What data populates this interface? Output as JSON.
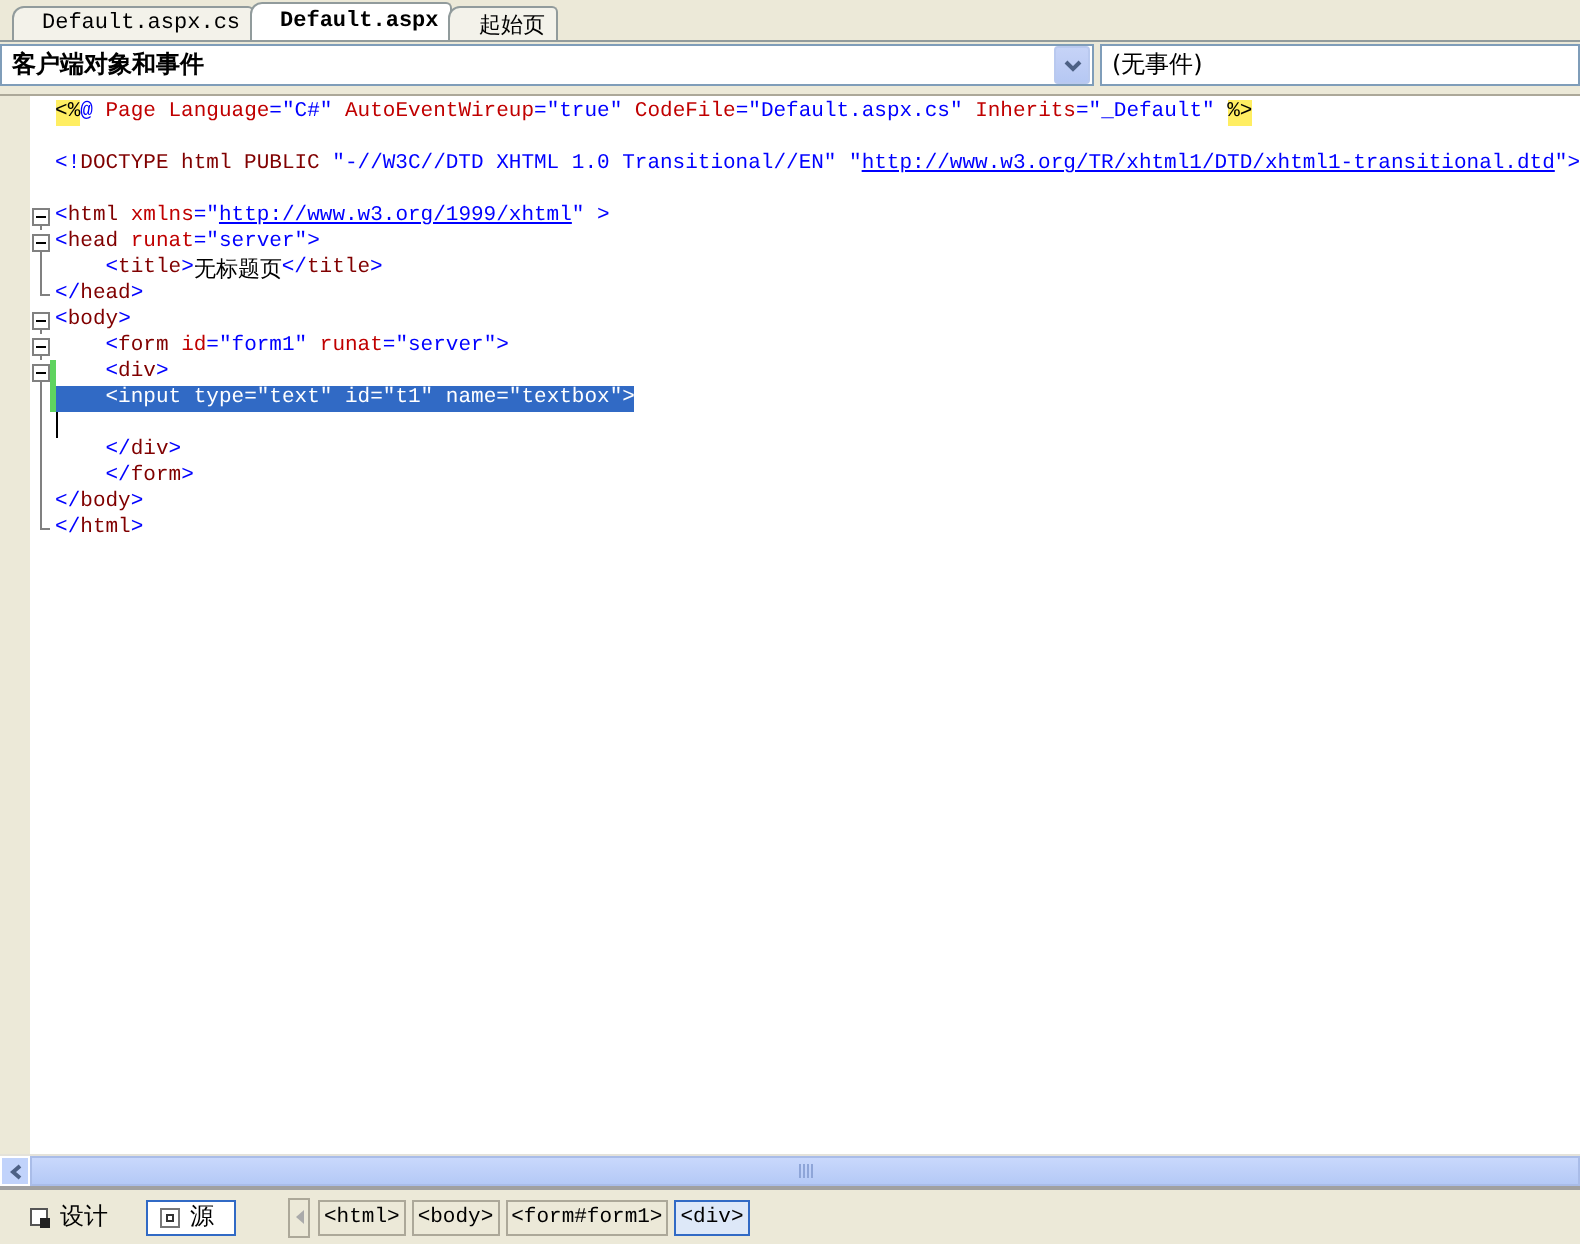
{
  "tabs": [
    {
      "label": "Default.aspx.cs",
      "selected": false
    },
    {
      "label": "Default.aspx",
      "selected": true
    },
    {
      "label": "起始页",
      "selected": false
    }
  ],
  "object_dropdown": {
    "value": "客户端对象和事件"
  },
  "event_dropdown": {
    "value": "(无事件)"
  },
  "code_lines": [
    {
      "kind": "plain",
      "changed": false,
      "selected": false,
      "cursor": false,
      "tokens": [
        {
          "kind": "directive",
          "text": "<%"
        },
        {
          "kind": "value",
          "text": "@"
        },
        {
          "kind": "attr",
          "text": " Page Language"
        },
        {
          "kind": "value",
          "text": "=\"C#\""
        },
        {
          "kind": "attr",
          "text": " AutoEventWireup"
        },
        {
          "kind": "value",
          "text": "=\"true\""
        },
        {
          "kind": "attr",
          "text": " CodeFile"
        },
        {
          "kind": "value",
          "text": "=\"Default.aspx.cs\""
        },
        {
          "kind": "attr",
          "text": " Inherits"
        },
        {
          "kind": "value",
          "text": "=\"_Default\" "
        },
        {
          "kind": "directive",
          "text": "%>"
        }
      ]
    },
    {
      "kind": "plain",
      "changed": false,
      "selected": false,
      "cursor": false
    },
    {
      "kind": "plain",
      "changed": false,
      "selected": false,
      "cursor": false,
      "tokens": [
        {
          "kind": "value",
          "text": "<!"
        },
        {
          "kind": "tag",
          "text": "DOCTYPE html PUBLIC"
        },
        {
          "kind": "value",
          "text": " \"-//W3C//DTD XHTML 1.0 Transitional//EN\" \""
        },
        {
          "kind": "link",
          "text": "http://www.w3.org/TR/xhtml1/DTD/xhtml1-transitional.dtd"
        },
        {
          "kind": "value",
          "text": "\">"
        }
      ]
    },
    {
      "kind": "plain",
      "changed": false,
      "selected": false,
      "cursor": false
    },
    {
      "kind": "open",
      "changed": false,
      "selected": false,
      "cursor": false,
      "tokens": [
        {
          "kind": "value",
          "text": "<"
        },
        {
          "kind": "tag",
          "text": "html"
        },
        {
          "kind": "attr",
          "text": " xmlns"
        },
        {
          "kind": "value",
          "text": "=\""
        },
        {
          "kind": "link",
          "text": "http://www.w3.org/1999/xhtml"
        },
        {
          "kind": "value",
          "text": "\" >"
        }
      ]
    },
    {
      "kind": "open",
      "changed": false,
      "selected": false,
      "cursor": false,
      "tokens": [
        {
          "kind": "value",
          "text": "<"
        },
        {
          "kind": "tag",
          "text": "head"
        },
        {
          "kind": "attr",
          "text": " runat"
        },
        {
          "kind": "value",
          "text": "=\"server\">"
        }
      ]
    },
    {
      "kind": "line",
      "changed": false,
      "selected": false,
      "cursor": false,
      "tokens": [
        {
          "kind": "value",
          "text": "    <"
        },
        {
          "kind": "tag",
          "text": "title"
        },
        {
          "kind": "value",
          "text": ">"
        },
        {
          "kind": "plain",
          "text": "无标题页"
        },
        {
          "kind": "value",
          "text": "</"
        },
        {
          "kind": "tag",
          "text": "title"
        },
        {
          "kind": "value",
          "text": ">"
        }
      ]
    },
    {
      "kind": "end",
      "changed": false,
      "selected": false,
      "cursor": false,
      "tokens": [
        {
          "kind": "value",
          "text": "</"
        },
        {
          "kind": "tag",
          "text": "head"
        },
        {
          "kind": "value",
          "text": ">"
        }
      ]
    },
    {
      "kind": "open",
      "changed": false,
      "selected": false,
      "cursor": false,
      "tokens": [
        {
          "kind": "value",
          "text": "<"
        },
        {
          "kind": "tag",
          "text": "body"
        },
        {
          "kind": "value",
          "text": ">"
        }
      ]
    },
    {
      "kind": "open",
      "changed": false,
      "selected": false,
      "cursor": false,
      "tokens": [
        {
          "kind": "value",
          "text": "    <"
        },
        {
          "kind": "tag",
          "text": "form"
        },
        {
          "kind": "attr",
          "text": " id"
        },
        {
          "kind": "value",
          "text": "=\"form1\""
        },
        {
          "kind": "attr",
          "text": " runat"
        },
        {
          "kind": "value",
          "text": "=\"server\">"
        }
      ]
    },
    {
      "kind": "open",
      "changed": true,
      "selected": false,
      "cursor": false,
      "tokens": [
        {
          "kind": "value",
          "text": "    <"
        },
        {
          "kind": "tag",
          "text": "div"
        },
        {
          "kind": "value",
          "text": ">"
        }
      ]
    },
    {
      "kind": "line",
      "changed": true,
      "selected": true,
      "cursor": false,
      "tokens": [
        {
          "kind": "value",
          "text": "    <"
        },
        {
          "kind": "tag",
          "text": "input"
        },
        {
          "kind": "attr",
          "text": " type"
        },
        {
          "kind": "value",
          "text": "=\"text\""
        },
        {
          "kind": "attr",
          "text": " id"
        },
        {
          "kind": "value",
          "text": "=\"t1\""
        },
        {
          "kind": "attr",
          "text": " name"
        },
        {
          "kind": "value",
          "text": "=\"textbox\">"
        }
      ]
    },
    {
      "kind": "line",
      "changed": false,
      "selected": false,
      "cursor": true
    },
    {
      "kind": "line",
      "changed": false,
      "selected": false,
      "cursor": false,
      "tokens": [
        {
          "kind": "value",
          "text": "    </"
        },
        {
          "kind": "tag",
          "text": "div"
        },
        {
          "kind": "value",
          "text": ">"
        }
      ]
    },
    {
      "kind": "line",
      "changed": false,
      "selected": false,
      "cursor": false,
      "tokens": [
        {
          "kind": "value",
          "text": "    </"
        },
        {
          "kind": "tag",
          "text": "form"
        },
        {
          "kind": "value",
          "text": ">"
        }
      ]
    },
    {
      "kind": "line",
      "changed": false,
      "selected": false,
      "cursor": false,
      "tokens": [
        {
          "kind": "value",
          "text": "</"
        },
        {
          "kind": "tag",
          "text": "body"
        },
        {
          "kind": "value",
          "text": ">"
        }
      ]
    },
    {
      "kind": "end",
      "changed": false,
      "selected": false,
      "cursor": false,
      "tokens": [
        {
          "kind": "value",
          "text": "</"
        },
        {
          "kind": "tag",
          "text": "html"
        },
        {
          "kind": "value",
          "text": ">"
        }
      ]
    }
  ],
  "view_buttons": [
    {
      "label": "设计",
      "selected": false
    },
    {
      "label": "源",
      "selected": true
    }
  ],
  "breadcrumbs": [
    {
      "label": "<html>",
      "selected": false
    },
    {
      "label": "<body>",
      "selected": false
    },
    {
      "label": "<form#form1>",
      "selected": false
    },
    {
      "label": "<div>",
      "selected": true
    }
  ]
}
